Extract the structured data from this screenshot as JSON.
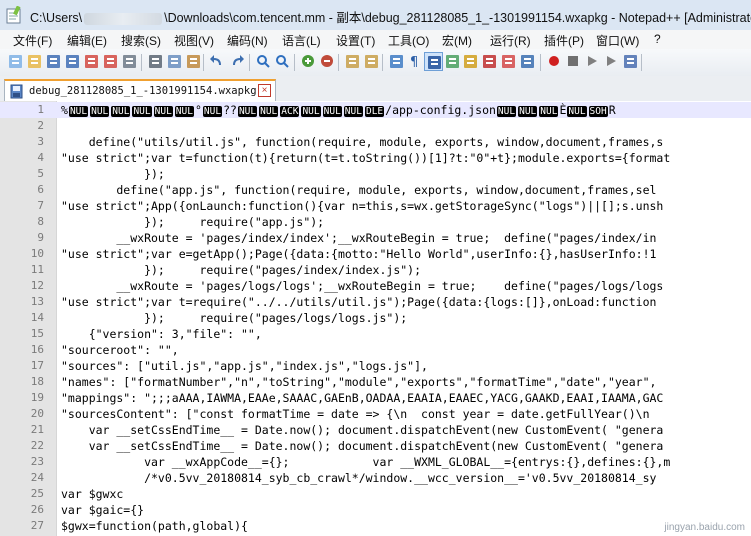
{
  "window": {
    "path_prefix": "C:\\Users\\",
    "path_suffix": "\\Downloads\\com.tencent.mm - 副本\\debug_281128085_1_-1301991154.wxapkg - Notepad++ [Administrator]"
  },
  "menu": [
    "文件(F)",
    "编辑(E)",
    "搜索(S)",
    "视图(V)",
    "编码(N)",
    "语言(L)",
    "设置(T)",
    "工具(O)",
    "宏(M)",
    "运行(R)",
    "插件(P)",
    "窗口(W)",
    "?"
  ],
  "toolbar_icons": [
    "new-file-icon",
    "open-file-icon",
    "save-icon",
    "save-all-icon",
    "close-icon",
    "close-all-icon",
    "print-icon",
    "cut-icon",
    "copy-icon",
    "paste-icon",
    "undo-icon",
    "redo-icon",
    "find-icon",
    "replace-icon",
    "zoom-in-icon",
    "zoom-out-icon",
    "sync-vertical-icon",
    "sync-horizontal-icon",
    "word-wrap-icon",
    "show-all-chars-icon",
    "indent-guide-icon",
    "user-language-icon",
    "doc-map-icon",
    "function-list-icon",
    "folder-workspace-icon",
    "monitor-icon",
    "record-macro-icon",
    "stop-macro-icon",
    "play-macro-icon",
    "run-macro-multiple-icon",
    "save-macro-icon"
  ],
  "tab": {
    "label": "debug_281128085_1_-1301991154.wxapkg",
    "close": "×"
  },
  "lines": [
    {
      "n": "1",
      "segs": [
        {
          "t": "%"
        },
        {
          "c": "NUL"
        },
        {
          "c": "NUL"
        },
        {
          "c": "NUL"
        },
        {
          "c": "NUL"
        },
        {
          "c": "NUL"
        },
        {
          "c": "NUL"
        },
        {
          "t": "°"
        },
        {
          "c": "NUL"
        },
        {
          "t": "??"
        },
        {
          "c": "NUL"
        },
        {
          "c": "NUL"
        },
        {
          "c": "ACK"
        },
        {
          "c": "NUL"
        },
        {
          "c": "NUL"
        },
        {
          "c": "NUL"
        },
        {
          "c": "DLE"
        },
        {
          "t": "/app-config.json"
        },
        {
          "c": "NUL"
        },
        {
          "c": "NUL"
        },
        {
          "c": "NUL"
        },
        {
          "t": "È"
        },
        {
          "c": "NUL"
        },
        {
          "c": "SOH"
        },
        {
          "t": "R"
        }
      ]
    },
    {
      "n": "2",
      "segs": [
        {
          "t": ""
        }
      ]
    },
    {
      "n": "3",
      "segs": [
        {
          "t": "    define(\"utils/util.js\", function(require, module, exports, window,document,frames,s"
        }
      ]
    },
    {
      "n": "4",
      "segs": [
        {
          "t": "\"use strict\";var t=function(t){return(t=t.toString())[1]?t:\"0\"+t};module.exports={format"
        }
      ]
    },
    {
      "n": "5",
      "segs": [
        {
          "t": "            });"
        }
      ]
    },
    {
      "n": "6",
      "segs": [
        {
          "t": "        define(\"app.js\", function(require, module, exports, window,document,frames,sel"
        }
      ]
    },
    {
      "n": "7",
      "segs": [
        {
          "t": "\"use strict\";App({onLaunch:function(){var n=this,s=wx.getStorageSync(\"logs\")||[];s.unsh"
        }
      ]
    },
    {
      "n": "8",
      "segs": [
        {
          "t": "            });     require(\"app.js\");"
        }
      ]
    },
    {
      "n": "9",
      "segs": [
        {
          "t": "        __wxRoute = 'pages/index/index';__wxRouteBegin = true;  define(\"pages/index/in"
        }
      ]
    },
    {
      "n": "10",
      "segs": [
        {
          "t": "\"use strict\";var e=getApp();Page({data:{motto:\"Hello World\",userInfo:{},hasUserInfo:!1"
        }
      ]
    },
    {
      "n": "11",
      "segs": [
        {
          "t": "            });     require(\"pages/index/index.js\");"
        }
      ]
    },
    {
      "n": "12",
      "segs": [
        {
          "t": "        __wxRoute = 'pages/logs/logs';__wxRouteBegin = true;    define(\"pages/logs/logs"
        }
      ]
    },
    {
      "n": "13",
      "segs": [
        {
          "t": "\"use strict\";var t=require(\"../../utils/util.js\");Page({data:{logs:[]},onLoad:function"
        }
      ]
    },
    {
      "n": "14",
      "segs": [
        {
          "t": "            });     require(\"pages/logs/logs.js\");"
        }
      ]
    },
    {
      "n": "15",
      "segs": [
        {
          "t": "    {\"version\": 3,\"file\": \"\","
        }
      ]
    },
    {
      "n": "16",
      "segs": [
        {
          "t": "\"sourceroot\": \"\","
        }
      ]
    },
    {
      "n": "17",
      "segs": [
        {
          "t": "\"sources\": [\"util.js\",\"app.js\",\"index.js\",\"logs.js\"],"
        }
      ]
    },
    {
      "n": "18",
      "segs": [
        {
          "t": "\"names\": [\"formatNumber\",\"n\",\"toString\",\"module\",\"exports\",\"formatTime\",\"date\",\"year\","
        }
      ]
    },
    {
      "n": "19",
      "segs": [
        {
          "t": "\"mappings\": \";;;aAAA,IAWMA,EAAe,SAAAC,GAEnB,OADAA,EAAIA,EAAEC,YACG,GAAKD,EAAI,IAAMA,GAC"
        }
      ]
    },
    {
      "n": "20",
      "segs": [
        {
          "t": "\"sourcesContent\": [\"const formatTime = date => {\\n  const year = date.getFullYear()\\n"
        }
      ]
    },
    {
      "n": "21",
      "segs": [
        {
          "t": "    var __setCssEndTime__ = Date.now(); document.dispatchEvent(new CustomEvent( \"genera"
        }
      ]
    },
    {
      "n": "22",
      "segs": [
        {
          "t": "    var __setCssEndTime__ = Date.now(); document.dispatchEvent(new CustomEvent( \"genera"
        }
      ]
    },
    {
      "n": "23",
      "segs": [
        {
          "t": "            var __wxAppCode__={};            var __WXML_GLOBAL__={entrys:{},defines:{},m"
        }
      ]
    },
    {
      "n": "24",
      "segs": [
        {
          "t": "            /*v0.5vv_20180814_syb_cb_crawl*/window.__wcc_version__='v0.5vv_20180814_sy"
        }
      ]
    },
    {
      "n": "25",
      "segs": [
        {
          "t": "var $gwxc"
        }
      ]
    },
    {
      "n": "26",
      "segs": [
        {
          "t": "var $gaic={}"
        }
      ]
    },
    {
      "n": "27",
      "segs": [
        {
          "t": "$gwx=function(path,global){"
        }
      ]
    }
  ],
  "watermark": "jingyan.baidu.com"
}
